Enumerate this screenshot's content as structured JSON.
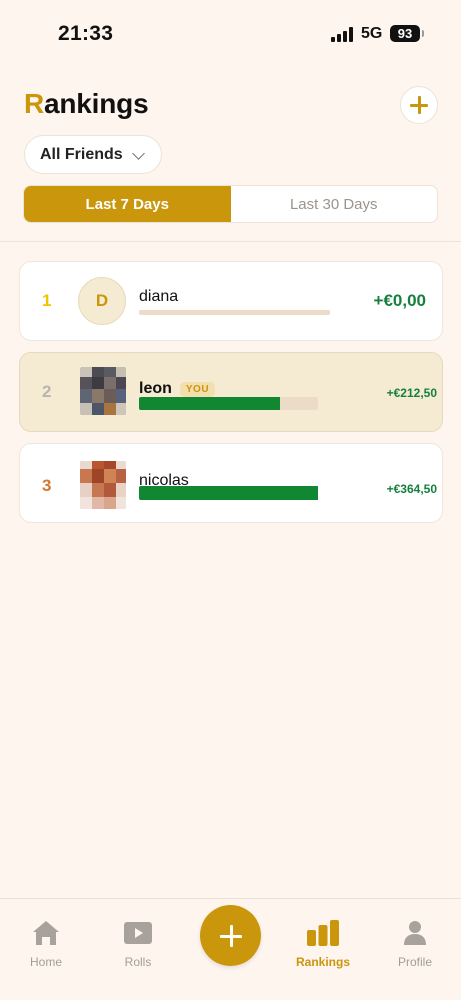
{
  "status_bar": {
    "time": "21:33",
    "network": "5G",
    "battery": "93"
  },
  "header": {
    "title_first": "R",
    "title_rest": "ankings",
    "add_icon": "plus-icon"
  },
  "filter": {
    "selected": "All Friends",
    "icon": "chevron-down-icon"
  },
  "period_tabs": [
    {
      "label": "Last 7 Days",
      "active": true
    },
    {
      "label": "Last 30 Days",
      "active": false
    }
  ],
  "leaderboard": [
    {
      "rank": "1",
      "name": "diana",
      "initial": "D",
      "amount": "+€0,00",
      "progress": 0.0,
      "rank_color": "#f2c200"
    },
    {
      "rank": "2",
      "name": "leon",
      "badge": "YOU",
      "amount": "+€212,50",
      "progress": 0.79,
      "rank_color": "#b9b4ad"
    },
    {
      "rank": "3",
      "name": "nicolas",
      "amount": "+€364,50",
      "progress": 1.0,
      "rank_color": "#d07a34"
    }
  ],
  "nav": {
    "home": "Home",
    "rolls": "Rolls",
    "rankings": "Rankings",
    "profile": "Profile",
    "active": "Rankings"
  },
  "colors": {
    "accent": "#c9960c",
    "positive": "#15803d",
    "bar_fill": "#118732",
    "background": "#fdf5ee"
  }
}
